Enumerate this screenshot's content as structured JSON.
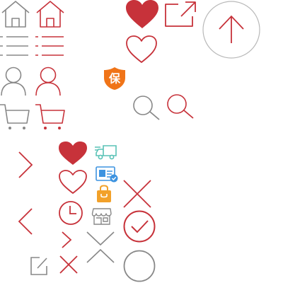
{
  "colors": {
    "gray": "#888888",
    "red": "#c7323a",
    "orange": "#f07418",
    "teal": "#59c2b6",
    "blue": "#3d93e0",
    "amber": "#f2a12a",
    "circle_gray": "#b9b9b9"
  },
  "icons": [
    {
      "name": "home-icon-gray"
    },
    {
      "name": "home-icon-red"
    },
    {
      "name": "heart-filled-icon"
    },
    {
      "name": "share-external-icon"
    },
    {
      "name": "scroll-top-icon"
    },
    {
      "name": "list-icon-gray"
    },
    {
      "name": "list-icon-red"
    },
    {
      "name": "heart-outline-icon"
    },
    {
      "name": "user-icon-gray"
    },
    {
      "name": "user-icon-red"
    },
    {
      "name": "insurance-shield-icon"
    },
    {
      "name": "cart-icon-gray"
    },
    {
      "name": "cart-icon-red"
    },
    {
      "name": "search-icon-gray"
    },
    {
      "name": "search-icon-red"
    },
    {
      "name": "chevron-right-icon"
    },
    {
      "name": "heart-filled-small-icon"
    },
    {
      "name": "delivery-truck-icon"
    },
    {
      "name": "id-card-verified-icon"
    },
    {
      "name": "heart-outline-small-icon"
    },
    {
      "name": "bag-icon"
    },
    {
      "name": "close-icon-large"
    },
    {
      "name": "chevron-left-icon"
    },
    {
      "name": "clock-icon"
    },
    {
      "name": "store-icon"
    },
    {
      "name": "check-circle-icon"
    },
    {
      "name": "chevron-right-small-icon"
    },
    {
      "name": "chevron-down-icon"
    },
    {
      "name": "chevron-up-icon"
    },
    {
      "name": "edit-icon"
    },
    {
      "name": "close-icon-small"
    },
    {
      "name": "empty-circle-icon"
    }
  ],
  "shield_badge": {
    "text": "保"
  }
}
